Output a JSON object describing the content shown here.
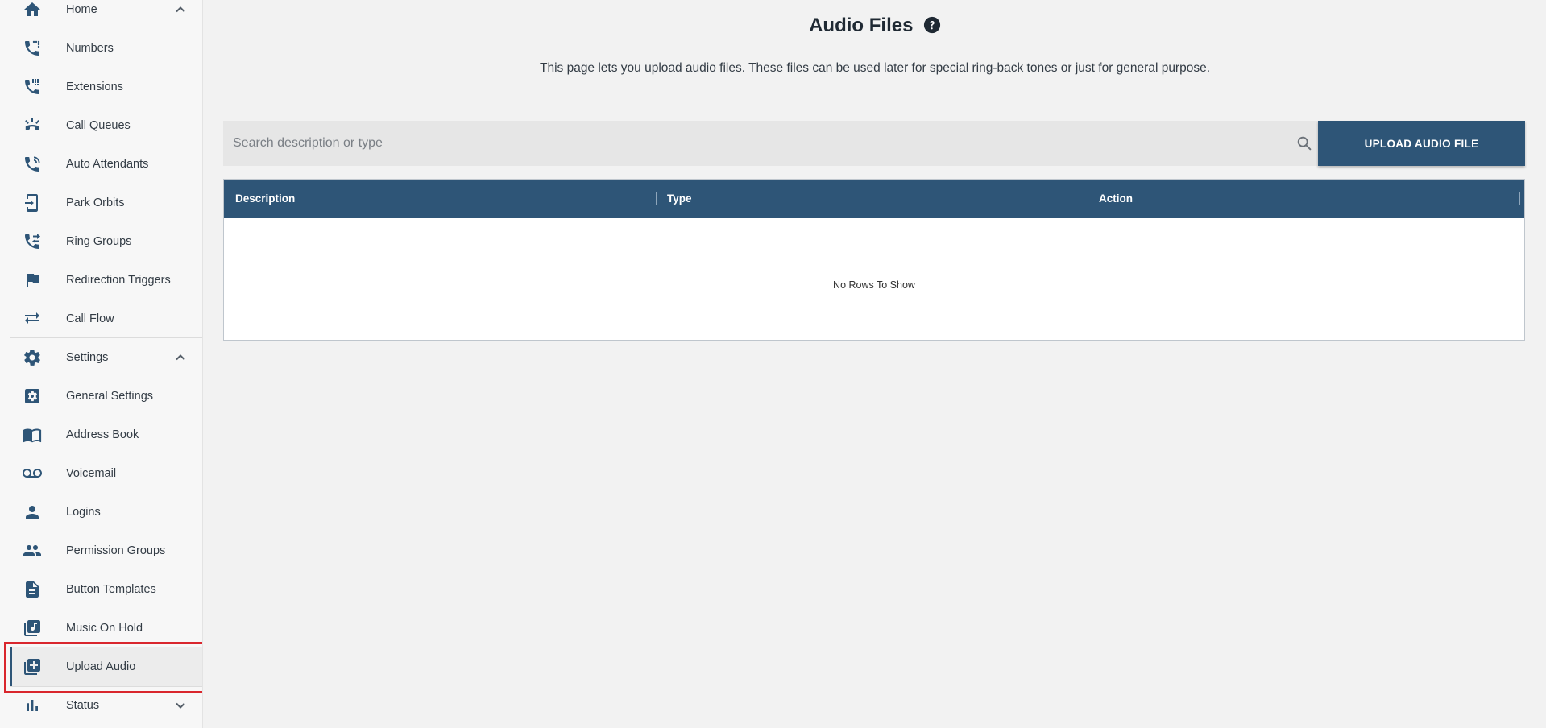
{
  "sidebar": {
    "items": [
      {
        "label": "Home",
        "icon": "home-icon"
      },
      {
        "label": "Numbers",
        "icon": "phone-numbers-icon"
      },
      {
        "label": "Extensions",
        "icon": "phone-dialpad-icon"
      },
      {
        "label": "Call Queues",
        "icon": "call-queue-icon"
      },
      {
        "label": "Auto Attendants",
        "icon": "auto-attendant-icon"
      },
      {
        "label": "Park Orbits",
        "icon": "park-orbit-icon"
      },
      {
        "label": "Ring Groups",
        "icon": "ring-group-icon"
      },
      {
        "label": "Redirection Triggers",
        "icon": "flag-icon"
      },
      {
        "label": "Call Flow",
        "icon": "swap-arrows-icon"
      },
      {
        "label": "Settings",
        "icon": "gear-icon"
      },
      {
        "label": "General Settings",
        "icon": "settings-box-icon"
      },
      {
        "label": "Address Book",
        "icon": "book-icon"
      },
      {
        "label": "Voicemail",
        "icon": "voicemail-icon"
      },
      {
        "label": "Logins",
        "icon": "person-icon"
      },
      {
        "label": "Permission Groups",
        "icon": "people-icon"
      },
      {
        "label": "Button Templates",
        "icon": "document-icon"
      },
      {
        "label": "Music On Hold",
        "icon": "music-library-icon"
      },
      {
        "label": "Upload Audio",
        "icon": "library-add-icon"
      },
      {
        "label": "Status",
        "icon": "bar-chart-icon"
      }
    ],
    "active_item": "Upload Audio"
  },
  "main": {
    "title": "Audio Files",
    "description": "This page lets you upload audio files. These files can be used later for special ring-back tones or just for general purpose.",
    "search": {
      "placeholder": "Search description or type",
      "value": ""
    },
    "upload_button_label": "UPLOAD AUDIO FILE",
    "table": {
      "columns": [
        "Description",
        "Type",
        "Action"
      ],
      "rows": [],
      "empty_message": "No Rows To Show"
    }
  },
  "colors": {
    "accent": "#2e5577",
    "highlight": "#d9262d",
    "background": "#f2f2f2"
  }
}
